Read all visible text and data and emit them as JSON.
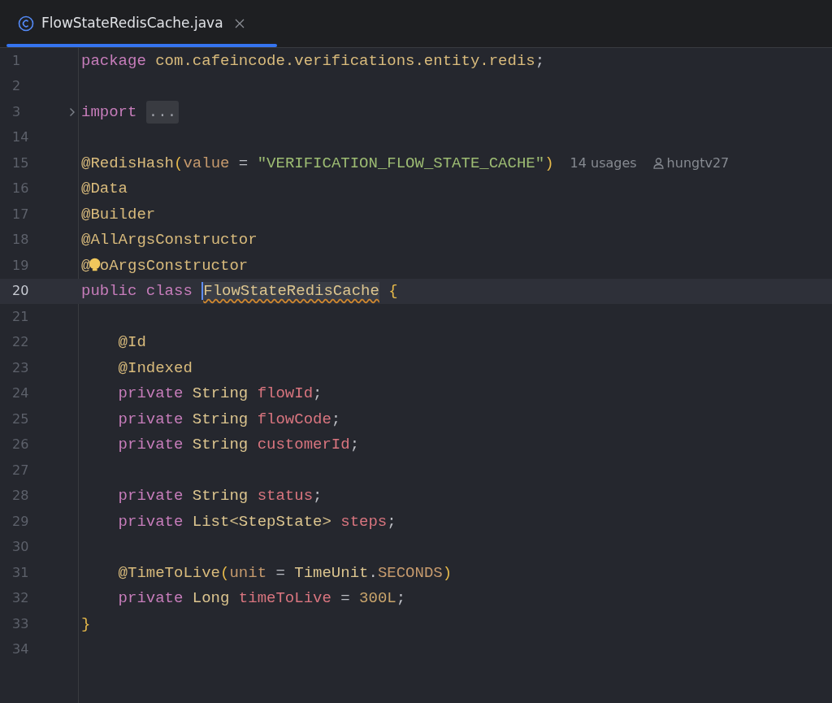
{
  "tab": {
    "label": "FlowStateRedisCache.java",
    "selected": true
  },
  "lines": [
    {
      "number": "1",
      "tokens": [
        {
          "kind": "keyword",
          "text": "package "
        },
        {
          "kind": "package",
          "text": "com.cafeincode.verifications.entity.redis"
        },
        {
          "kind": "punct",
          "text": ";"
        }
      ]
    },
    {
      "number": "2"
    },
    {
      "number": "3",
      "fold": true,
      "tokens": [
        {
          "kind": "keyword",
          "text": "import "
        },
        {
          "kind": "folded",
          "text": "..."
        }
      ]
    },
    {
      "number": "14"
    },
    {
      "number": "15",
      "tokens": [
        {
          "kind": "annotation",
          "text": "@RedisHash"
        },
        {
          "kind": "paren",
          "text": "("
        },
        {
          "kind": "param",
          "text": "value"
        },
        {
          "kind": "punct",
          "text": " = "
        },
        {
          "kind": "string",
          "text": "\"VERIFICATION_FLOW_STATE_CACHE\""
        },
        {
          "kind": "paren",
          "text": ")"
        }
      ],
      "hints": {
        "usages": "14 usages",
        "author": "hungtv27"
      }
    },
    {
      "number": "16",
      "tokens": [
        {
          "kind": "annotation",
          "text": "@Data"
        }
      ]
    },
    {
      "number": "17",
      "tokens": [
        {
          "kind": "annotation",
          "text": "@Builder"
        }
      ]
    },
    {
      "number": "18",
      "tokens": [
        {
          "kind": "annotation",
          "text": "@AllArgsConstructor"
        }
      ]
    },
    {
      "number": "19",
      "bulb": true,
      "tokens": [
        {
          "kind": "annotation",
          "text": "@"
        },
        {
          "kind": "annotation",
          "text": "oArgsConstructor"
        }
      ]
    },
    {
      "number": "20",
      "current": true,
      "tokens": [
        {
          "kind": "keyword",
          "text": "public class "
        },
        {
          "kind": "type",
          "text": "FlowStateRedisCache",
          "warning": true,
          "caret": true
        },
        {
          "kind": "paren",
          "text": " {"
        }
      ]
    },
    {
      "number": "21"
    },
    {
      "number": "22",
      "indented": true,
      "tokens": [
        {
          "kind": "annotation",
          "text": "@Id"
        }
      ]
    },
    {
      "number": "23",
      "indented": true,
      "tokens": [
        {
          "kind": "annotation",
          "text": "@Indexed"
        }
      ]
    },
    {
      "number": "24",
      "indented": true,
      "tokens": [
        {
          "kind": "keyword",
          "text": "private "
        },
        {
          "kind": "type",
          "text": "String "
        },
        {
          "kind": "field",
          "text": "flowId"
        },
        {
          "kind": "punct",
          "text": ";"
        }
      ]
    },
    {
      "number": "25",
      "indented": true,
      "tokens": [
        {
          "kind": "keyword",
          "text": "private "
        },
        {
          "kind": "type",
          "text": "String "
        },
        {
          "kind": "field",
          "text": "flowCode"
        },
        {
          "kind": "punct",
          "text": ";"
        }
      ]
    },
    {
      "number": "26",
      "indented": true,
      "tokens": [
        {
          "kind": "keyword",
          "text": "private "
        },
        {
          "kind": "type",
          "text": "String "
        },
        {
          "kind": "field",
          "text": "customerId"
        },
        {
          "kind": "punct",
          "text": ";"
        }
      ]
    },
    {
      "number": "27"
    },
    {
      "number": "28",
      "indented": true,
      "tokens": [
        {
          "kind": "keyword",
          "text": "private "
        },
        {
          "kind": "type",
          "text": "String "
        },
        {
          "kind": "field",
          "text": "status"
        },
        {
          "kind": "punct",
          "text": ";"
        }
      ]
    },
    {
      "number": "29",
      "indented": true,
      "tokens": [
        {
          "kind": "keyword",
          "text": "private "
        },
        {
          "kind": "type",
          "text": "List<StepState> "
        },
        {
          "kind": "field",
          "text": "steps"
        },
        {
          "kind": "punct",
          "text": ";"
        }
      ]
    },
    {
      "number": "30"
    },
    {
      "number": "31",
      "indented": true,
      "tokens": [
        {
          "kind": "annotation",
          "text": "@TimeToLive"
        },
        {
          "kind": "paren",
          "text": "("
        },
        {
          "kind": "param",
          "text": "unit"
        },
        {
          "kind": "punct",
          "text": " = "
        },
        {
          "kind": "type",
          "text": "TimeUnit"
        },
        {
          "kind": "punct",
          "text": "."
        },
        {
          "kind": "constant",
          "text": "SECONDS"
        },
        {
          "kind": "paren",
          "text": ")"
        }
      ]
    },
    {
      "number": "32",
      "indented": true,
      "tokens": [
        {
          "kind": "keyword",
          "text": "private "
        },
        {
          "kind": "type",
          "text": "Long "
        },
        {
          "kind": "field",
          "text": "timeToLive"
        },
        {
          "kind": "punct",
          "text": " = "
        },
        {
          "kind": "number",
          "text": "300L"
        },
        {
          "kind": "punct",
          "text": ";"
        }
      ]
    },
    {
      "number": "33",
      "tokens": [
        {
          "kind": "paren",
          "text": "}"
        }
      ]
    },
    {
      "number": "34"
    }
  ]
}
